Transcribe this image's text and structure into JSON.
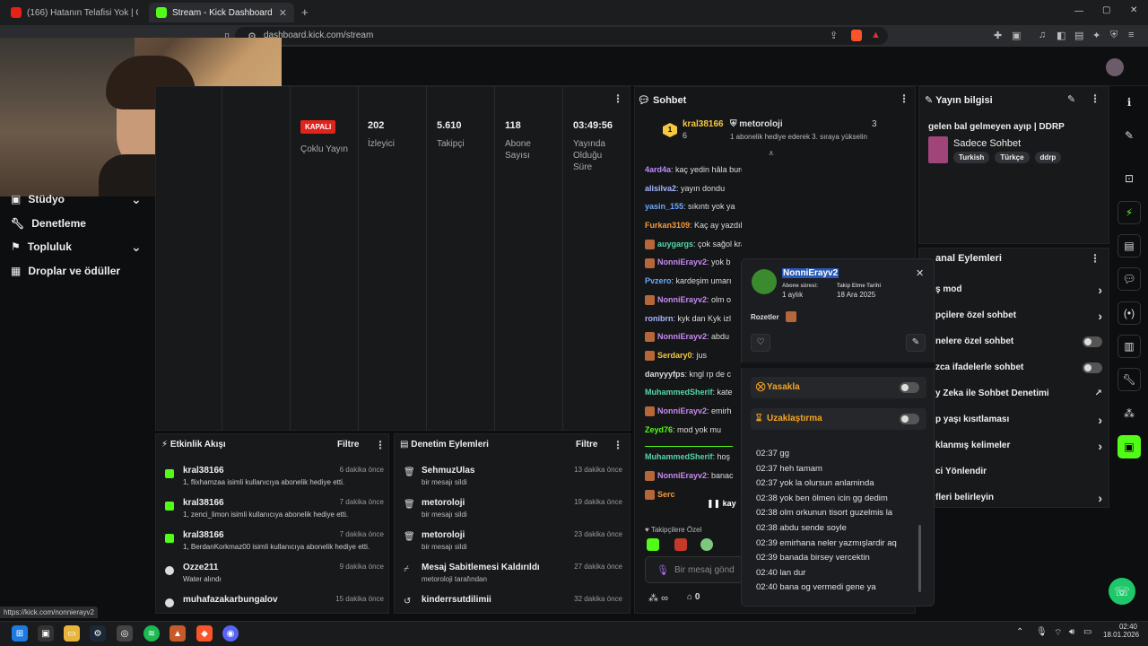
{
  "browser": {
    "tabs": [
      {
        "title": "(166) Hatanın Telafisi Yok | Orkun Kö…"
      },
      {
        "title": "Stream - Kick Dashboard"
      }
    ],
    "new_tab": "+",
    "url": "dashboard.kick.com/stream",
    "window_controls": [
      "—",
      "▢",
      "✕"
    ],
    "status_url": "https://kick.com/nonnierayv2"
  },
  "sidebar": {
    "items": [
      {
        "label": "Stüdyo"
      },
      {
        "label": "Denetleme"
      },
      {
        "label": "Topluluk"
      },
      {
        "label": "Droplar ve ödüller"
      }
    ]
  },
  "stats": {
    "status_badge": "KAPALI",
    "multi_stream": "Çoklu Yayın",
    "cols": [
      {
        "value": "202",
        "label": "İzleyici"
      },
      {
        "value": "5.610",
        "label": "Takipçi"
      },
      {
        "value": "118",
        "label": "Abone Sayısı"
      },
      {
        "value": "03:49:56",
        "label": "Yayında Olduğu Süre"
      }
    ]
  },
  "activity": {
    "title": "Etkinlik Akışı",
    "filter": "Filtre",
    "rows": [
      {
        "user": "kral38166",
        "time": "6 dakika önce",
        "detail": "1, flixhamzaa isimli kullanıcıya abonelik hediye etti."
      },
      {
        "user": "kral38166",
        "time": "7 dakika önce",
        "detail": "1, zenci_limon isimli kullanıcıya abonelik hediye etti."
      },
      {
        "user": "kral38166",
        "time": "7 dakika önce",
        "detail": "1, BerdanKorkmaz00 isimli kullanıcıya abonelik hediye etti."
      },
      {
        "user": "Ozze211",
        "time": "9 dakika önce",
        "detail": "Water alındı"
      },
      {
        "user": "muhafazakarbungalov",
        "time": "15 dakika önce",
        "detail": ""
      }
    ]
  },
  "modlog": {
    "title": "Denetim Eylemleri",
    "filter": "Filtre",
    "rows": [
      {
        "user": "SehmuzUlas",
        "time": "13 dakika önce",
        "detail": "bir mesajı sildi"
      },
      {
        "user": "metoroloji",
        "time": "19 dakika önce",
        "detail": "bir mesajı sildi"
      },
      {
        "user": "metoroloji",
        "time": "23 dakika önce",
        "detail": "bir mesajı sildi"
      },
      {
        "user": "Mesaj Sabitlemesi Kaldırıldı",
        "time": "27 dakika önce",
        "detail": "metoroloji tarafından"
      },
      {
        "user": "kinderrsutdilimii",
        "time": "32 dakika önce",
        "detail": ""
      }
    ]
  },
  "chat": {
    "title": "Sohbet",
    "pinned": {
      "user1": "kral38166",
      "count1": "6",
      "user2": "metoroloji",
      "count2": "3",
      "note": "1 abonelik hediye ederek 3. sıraya yükselin"
    },
    "lines": [
      {
        "user": "4ard4a",
        "color": "#b98cf6",
        "msg": ": kaç yedin hâla burdasının"
      },
      {
        "user": "alisilva2",
        "color": "#a7b6ff",
        "msg": ": yayın dondu"
      },
      {
        "user": "yasin_155",
        "color": "#6aa8ff",
        "msg": ": sıkıntı yok ya"
      },
      {
        "user": "Furkan3109",
        "color": "#f59a3c",
        "msg": ": Kaç ay yazdılar ya"
      },
      {
        "user": "auygargs",
        "color": "#56d6a6",
        "msg": ": çok sağol kral"
      },
      {
        "user": "NonniErayv2",
        "color": "#c68bf0",
        "msg": ": yok b"
      },
      {
        "user": "Pvzero",
        "color": "#6aa8ff",
        "msg": ": kardeşim umarı"
      },
      {
        "user": "NonniErayv2",
        "color": "#c68bf0",
        "msg": ": olm o"
      },
      {
        "user": "ronibrn",
        "color": "#a7b6ff",
        "msg": ": kyk dan Kyk izl"
      },
      {
        "user": "NonniErayv2",
        "color": "#c68bf0",
        "msg": ": abdu"
      },
      {
        "user": "Serdary0",
        "color": "#f5c842",
        "msg": ": jus"
      },
      {
        "user": "danyyyfps",
        "color": "#dddddd",
        "msg": ": kngl rp de c"
      },
      {
        "user": "MuhammedSherif",
        "color": "#56d6a6",
        "msg": ": kate"
      },
      {
        "user": "NonniErayv2",
        "color": "#c68bf0",
        "msg": ": emirh"
      },
      {
        "user": "Zeyd76",
        "color": "#53fc18",
        "msg": ": mod yok mu"
      },
      {
        "user": "MuhammedSherif",
        "color": "#56d6a6",
        "msg": ": hoş"
      },
      {
        "user": "NonniErayv2",
        "color": "#c68bf0",
        "msg": ": banac"
      },
      {
        "user": "Serc",
        "color": "#f59a3c",
        "msg": ""
      }
    ],
    "pause_label": "kay",
    "followers_only": "Takipçilere Özel",
    "input_placeholder": "Bir mesaj gönd",
    "infinity": "∞",
    "points": "0"
  },
  "popup": {
    "username": "NonniErayv2",
    "sub_label": "Abone süresi:",
    "sub_value": "1 aylık",
    "follow_label": "Takip Etme Tarihi",
    "follow_value": "18 Ara 2025",
    "badges_label": "Rozetler",
    "ban_label": "Yasakla",
    "timeout_label": "Uzaklaştırma",
    "history": [
      {
        "time": "02:37",
        "msg": "gg"
      },
      {
        "time": "02:37",
        "msg": "heh tamam"
      },
      {
        "time": "02:37",
        "msg": "yok la olursun anlaminda"
      },
      {
        "time": "02:38",
        "msg": "yok ben ölmen icin gg dedim"
      },
      {
        "time": "02:38",
        "msg": "olm orkunun tisort guzelmis la"
      },
      {
        "time": "02:38",
        "msg": "abdu sende soyle"
      },
      {
        "time": "02:39",
        "msg": "emirhana neler yazmışlardir aq"
      },
      {
        "time": "02:39",
        "msg": "banada birsey vercektin"
      },
      {
        "time": "02:40",
        "msg": "lan dur"
      },
      {
        "time": "02:40",
        "msg": "bana og vermedi gene ya"
      }
    ]
  },
  "stream_info": {
    "title": "Yayın bilgisi",
    "stream_title": "gelen bal gelmeyen ayıp | DDRP",
    "category": "Sadece Sohbet",
    "tags": [
      "Turkish",
      "Türkçe",
      "ddrp"
    ]
  },
  "channel_actions": {
    "title": "anal Eylemleri",
    "rows": [
      {
        "label": "ş mod",
        "kind": "chevron"
      },
      {
        "label": "pçilere özel sohbet",
        "kind": "chevron"
      },
      {
        "label": "nelere özel sohbet",
        "kind": "toggle"
      },
      {
        "label": "zca ifadelerle sohbet",
        "kind": "toggle"
      },
      {
        "label": "y Zeka ile Sohbet Denetimi",
        "kind": "external"
      },
      {
        "label": "p yaşı kısıtlaması",
        "kind": "chevron"
      },
      {
        "label": "klanmış kelimeler",
        "kind": "chevron"
      },
      {
        "label": "ci Yönlendir",
        "kind": "none"
      },
      {
        "label": "fleri belirleyin",
        "kind": "chevron"
      }
    ]
  },
  "taskbar": {
    "time": "02:40",
    "date": "18.01.2026"
  }
}
